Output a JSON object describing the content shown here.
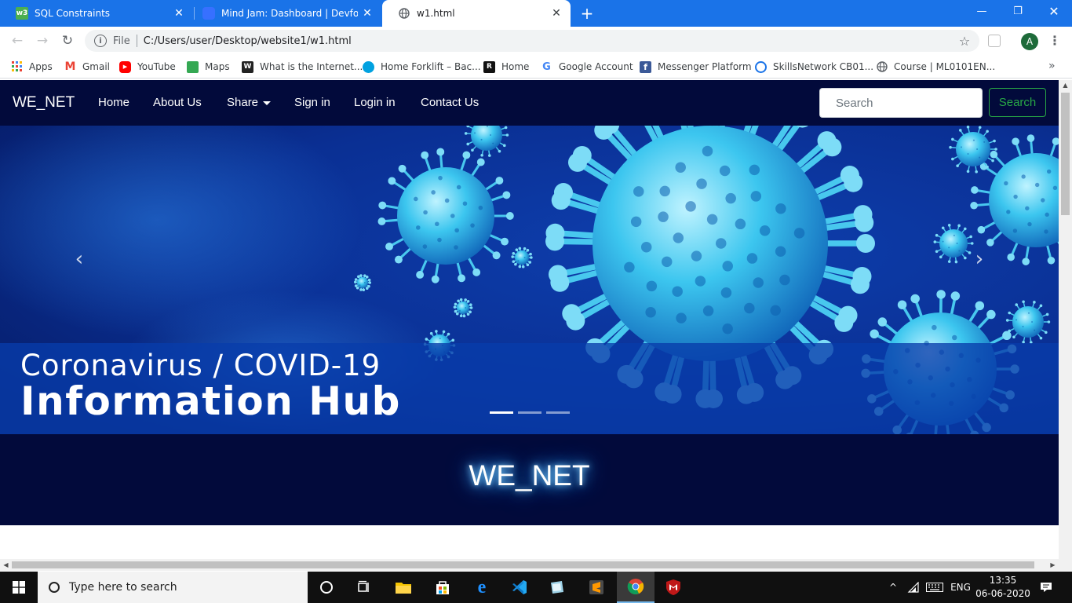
{
  "browser": {
    "tabs": [
      {
        "title": "SQL Constraints",
        "favicon": "w3schools-icon",
        "active": false
      },
      {
        "title": "Mind Jam: Dashboard | Devfolio",
        "favicon": "devfolio-icon",
        "active": false
      },
      {
        "title": "w1.html",
        "favicon": "globe-icon",
        "active": true
      }
    ],
    "address": {
      "scheme_label": "File",
      "url": "C:/Users/user/Desktop/website1/w1.html"
    },
    "profile_initial": "A",
    "accent_color": "#1a73e8",
    "bookmarks": [
      {
        "label": "Apps",
        "icon": "apps-grid-icon"
      },
      {
        "label": "Gmail",
        "icon": "gmail-icon"
      },
      {
        "label": "YouTube",
        "icon": "youtube-icon"
      },
      {
        "label": "Maps",
        "icon": "maps-icon"
      },
      {
        "label": "What is the Internet...",
        "icon": "bookmark-w-icon"
      },
      {
        "label": "Home Forklift – Bac...",
        "icon": "salesforce-icon"
      },
      {
        "label": "Home",
        "icon": "r-icon"
      },
      {
        "label": "Google Account",
        "icon": "google-icon"
      },
      {
        "label": "Messenger Platform",
        "icon": "facebook-icon"
      },
      {
        "label": "SkillsNetwork CB01...",
        "icon": "ring-icon"
      },
      {
        "label": "Course | ML0101EN...",
        "icon": "globe-icon"
      }
    ]
  },
  "site": {
    "brand": "WE_NET",
    "nav": [
      {
        "label": "Home"
      },
      {
        "label": "About Us"
      },
      {
        "label": "Share",
        "dropdown": true
      },
      {
        "label": "Sign in"
      },
      {
        "label": "Login in"
      },
      {
        "label": "Contact Us"
      }
    ],
    "search": {
      "placeholder": "Search",
      "button_label": "Search"
    },
    "carousel": {
      "caption_line1": "Coronavirus / COVID-19",
      "caption_line2": "Information Hub",
      "slide_count": 3,
      "active_slide": 0,
      "prev_icon": "chevron-left-icon",
      "next_icon": "chevron-right-icon"
    },
    "footer_brand": "WE_NET",
    "colors": {
      "navbar": "#020a3b",
      "search_button": "#28a745",
      "glow": "#3aa9ff"
    }
  },
  "taskbar": {
    "search_placeholder": "Type here to search",
    "language": "ENG",
    "time": "13:35",
    "date": "06-06-2020",
    "pinned": [
      "cortana-icon",
      "task-view-icon",
      "file-explorer-icon",
      "store-icon",
      "edge-icon",
      "vscode-icon",
      "app-icon",
      "sublime-icon",
      "chrome-icon",
      "mcafee-icon"
    ]
  }
}
